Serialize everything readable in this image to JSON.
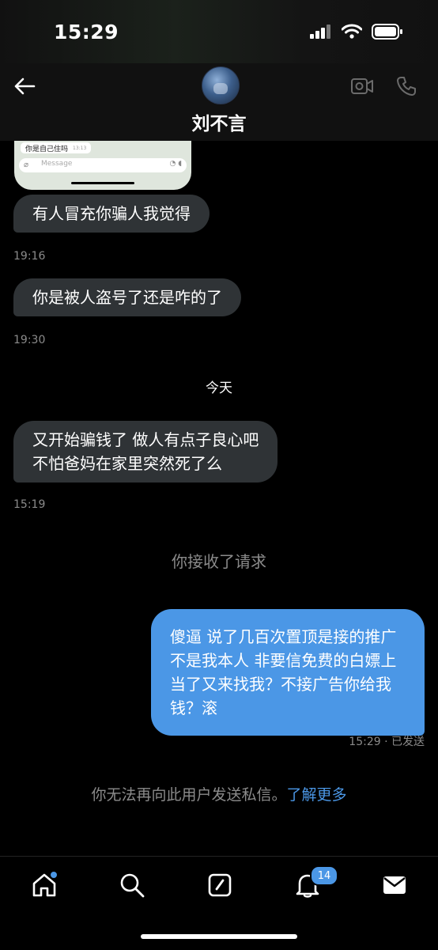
{
  "status_bar": {
    "time": "15:29"
  },
  "header": {
    "contact_name": "刘不言"
  },
  "shared_image": {
    "bubble_text": "你是自己住吗",
    "bubble_time": "13:13",
    "input_placeholder": "Message"
  },
  "messages": [
    {
      "text": "有人冒充你骗人我觉得",
      "time": "19:16"
    },
    {
      "text": "你是被人盗号了还是咋的了",
      "time": "19:30"
    },
    {
      "lines": [
        "又开始骗钱了 做人有点子良心吧",
        "不怕爸妈在家里突然死了么"
      ],
      "time": "15:19"
    }
  ],
  "day_separator": "今天",
  "system_note": "你接收了请求",
  "outgoing": {
    "lines": [
      "傻逼 说了几百次置顶是接的推广",
      "不是我本人 非要信免费的白嫖上",
      "当了又来找我？不接广告你给我",
      "钱？滚"
    ],
    "meta": "15:29 · 已发送"
  },
  "blocked_notice": {
    "text": "你无法再向此用户发送私信。",
    "link": "了解更多"
  },
  "tab_bar": {
    "notification_count": "14",
    "items": [
      "home",
      "search",
      "compose",
      "notifications",
      "messages"
    ]
  },
  "colors": {
    "accent": "#4b97e6",
    "incoming_bubble": "#2f3336",
    "muted_text": "#8b8b8b",
    "background": "#000000"
  }
}
